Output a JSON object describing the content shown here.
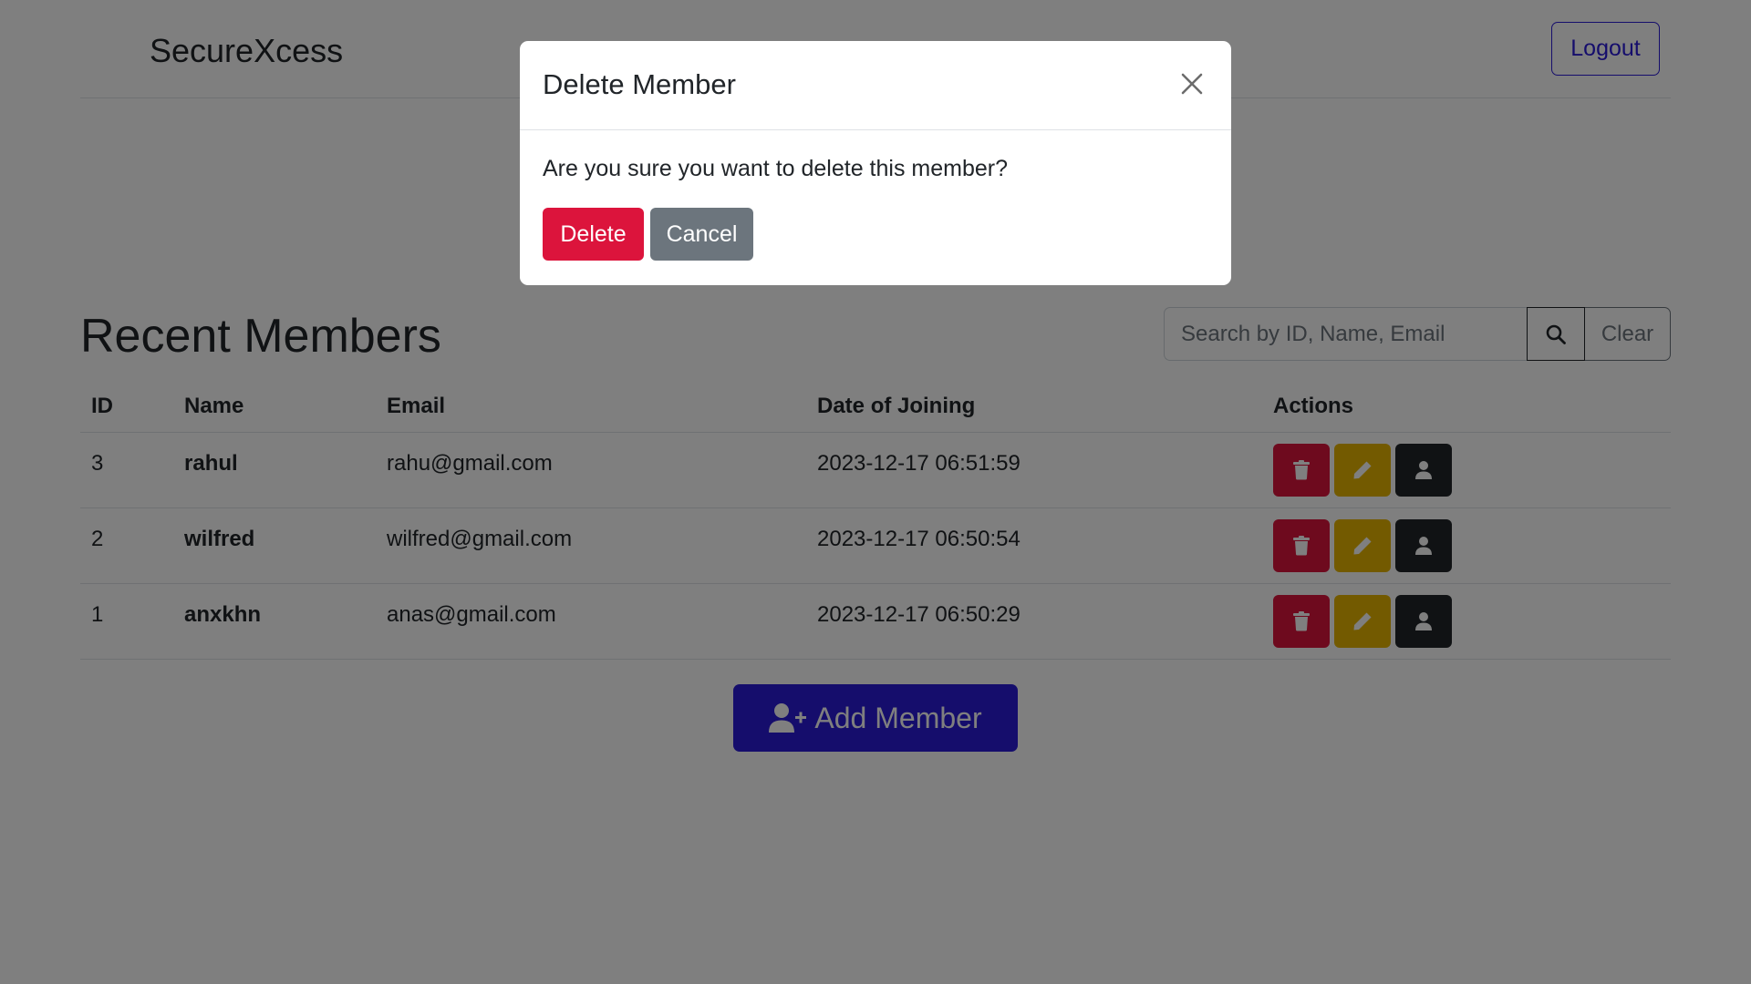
{
  "header": {
    "brand": "SecureXcess",
    "logout_label": "Logout"
  },
  "members": {
    "title": "Recent Members",
    "search": {
      "placeholder": "Search by ID, Name, Email",
      "value": "",
      "search_icon": "search-icon",
      "clear_label": "Clear"
    },
    "columns": [
      "ID",
      "Name",
      "Email",
      "Date of Joining",
      "Actions"
    ],
    "rows": [
      {
        "id": "3",
        "name": "rahul",
        "email": "rahu@gmail.com",
        "joined": "2023-12-17 06:51:59"
      },
      {
        "id": "2",
        "name": "wilfred",
        "email": "wilfred@gmail.com",
        "joined": "2023-12-17 06:50:54"
      },
      {
        "id": "1",
        "name": "anxkhn",
        "email": "anas@gmail.com",
        "joined": "2023-12-17 06:50:29"
      }
    ],
    "row_actions": {
      "delete_icon": "trash-icon",
      "edit_icon": "pencil-icon",
      "view_icon": "user-icon"
    },
    "add_member_label": "Add Member",
    "add_member_icon": "user-plus-icon"
  },
  "modal": {
    "title": "Delete Member",
    "message": "Are you sure you want to delete this member?",
    "delete_label": "Delete",
    "cancel_label": "Cancel",
    "close_icon": "close-icon"
  },
  "colors": {
    "primary": "#2a1ad8",
    "danger": "#dc143c",
    "warning": "#e6b400",
    "dark": "#212529",
    "secondary": "#6c757d",
    "backdrop": "rgba(0,0,0,0.5)"
  }
}
